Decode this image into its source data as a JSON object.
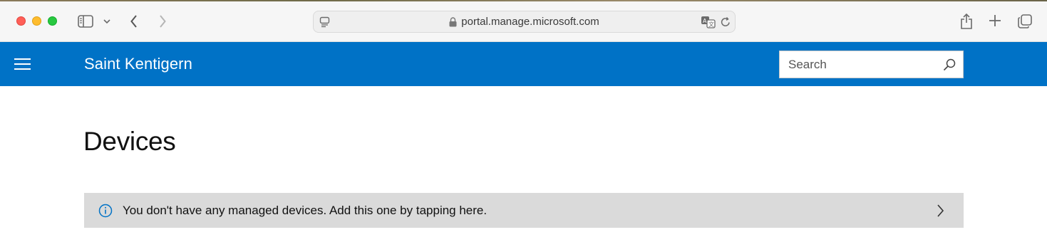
{
  "browser": {
    "url": "portal.manage.microsoft.com",
    "icons": {
      "sidebar": "sidebar-icon",
      "sidebar_menu": "chevron-down-icon",
      "back": "chevron-left-icon",
      "forward": "chevron-right-icon",
      "tab_overview": "page-menu-icon",
      "lock": "lock-icon",
      "translate": "translate-icon",
      "reload": "reload-icon",
      "share": "share-icon",
      "new_tab": "plus-icon",
      "tabs": "tabs-icon"
    }
  },
  "header": {
    "org_name": "Saint Kentigern",
    "menu_icon": "hamburger-icon",
    "search": {
      "placeholder": "Search",
      "value": "",
      "icon": "search-icon"
    },
    "color": "#0072c6"
  },
  "main": {
    "title": "Devices",
    "notice": {
      "icon": "info-icon",
      "text": "You don't have any managed devices. Add this one by tapping here.",
      "chevron": "chevron-right-icon",
      "background": "#dadada",
      "icon_color": "#0072c6"
    }
  }
}
